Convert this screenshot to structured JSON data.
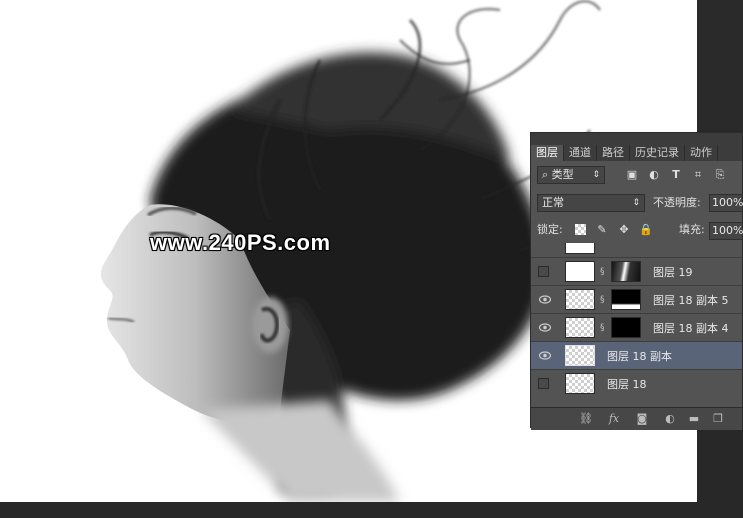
{
  "watermark": "www.240PS.com",
  "panel": {
    "tabs": [
      {
        "label": "图层",
        "active": true
      },
      {
        "label": "通道",
        "active": false
      },
      {
        "label": "路径",
        "active": false
      },
      {
        "label": "历史记录",
        "active": false
      },
      {
        "label": "动作",
        "active": false
      }
    ],
    "filter_kind": "类型",
    "blend_mode": "正常",
    "opacity_label": "不透明度:",
    "opacity_value": "100%",
    "lock_label": "锁定:",
    "fill_label": "填充:",
    "fill_value": "100%",
    "layers": [
      {
        "name": "图层 19",
        "visible": false,
        "thumb": "white",
        "mask": "smoke",
        "selected": false
      },
      {
        "name": "图层 18 副本 5",
        "visible": true,
        "thumb": "checker",
        "mask": "black-white-bottom",
        "selected": false
      },
      {
        "name": "图层 18 副本 4",
        "visible": true,
        "thumb": "checker",
        "mask": "black",
        "selected": false
      },
      {
        "name": "图层 18 副本",
        "visible": true,
        "thumb": "checker",
        "mask": "",
        "selected": true
      },
      {
        "name": "图层 18",
        "visible": false,
        "thumb": "checker",
        "mask": "",
        "selected": false
      }
    ],
    "bottom_icons": [
      "link-icon",
      "fx-icon",
      "mask-icon",
      "adjustment-icon",
      "folder-icon",
      "new-layer-icon"
    ]
  }
}
